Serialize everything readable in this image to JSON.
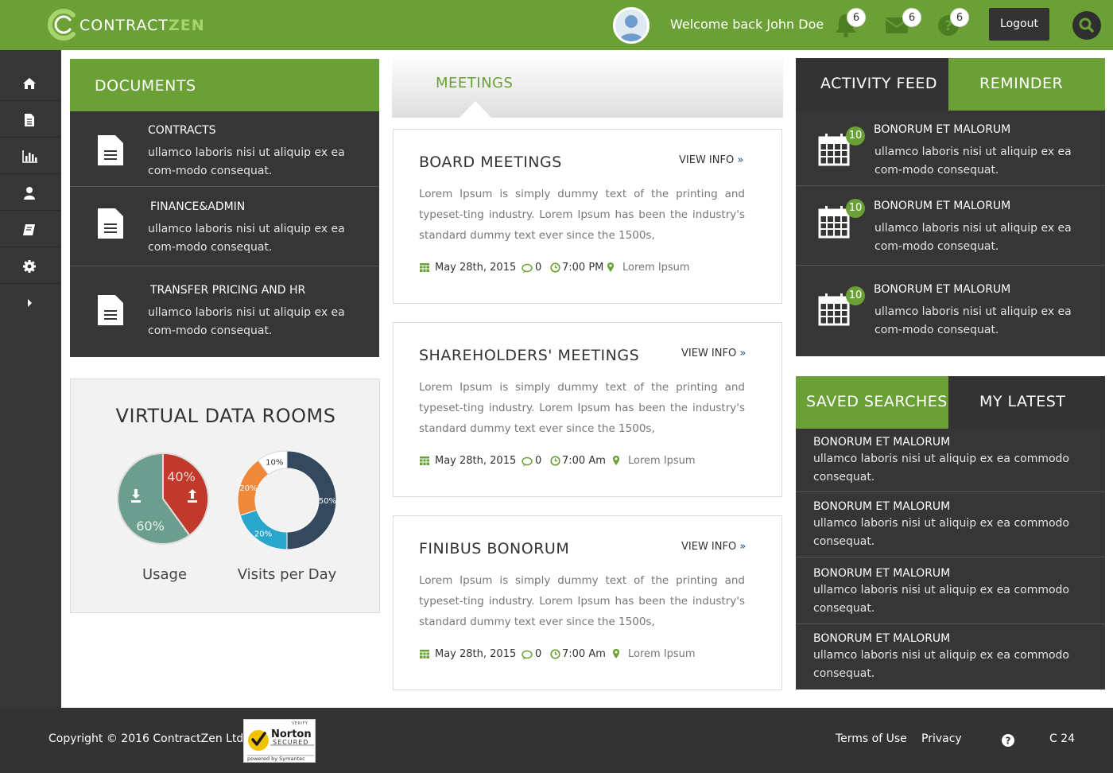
{
  "header": {
    "logo_part1": "CONTRACT",
    "logo_part2": "ZEN",
    "welcome": "Welcome back John Doe",
    "notifications": [
      {
        "icon": "bell-icon",
        "count": "6"
      },
      {
        "icon": "envelope-icon",
        "count": "6"
      },
      {
        "icon": "question-icon",
        "count": "6"
      }
    ],
    "logout_label": "Logout",
    "accent": "#6aa035"
  },
  "sidebar": {
    "items": [
      {
        "icon": "home-icon"
      },
      {
        "icon": "document-icon"
      },
      {
        "icon": "bar-chart-icon"
      },
      {
        "icon": "user-icon"
      },
      {
        "icon": "book-icon"
      },
      {
        "icon": "gear-icon"
      },
      {
        "icon": "chevron-right-icon"
      }
    ]
  },
  "documents": {
    "title": "DOCUMENTS",
    "items": [
      {
        "title": "CONTRACTS",
        "desc": "ullamco laboris nisi ut aliquip ex ea com-modo consequat."
      },
      {
        "title": "FINANCE&ADMIN",
        "desc": "ullamco laboris nisi ut aliquip ex ea com-modo consequat."
      },
      {
        "title": "TRANSFER PRICING AND HR",
        "desc": "ullamco laboris nisi ut aliquip ex ea com-modo consequat."
      }
    ]
  },
  "vdr": {
    "title": "VIRTUAL DATA ROOMS",
    "usage_label": "Usage",
    "visits_label": "Visits per Day"
  },
  "chart_data": [
    {
      "type": "pie",
      "title": "Usage",
      "categories": [
        "Download",
        "Upload"
      ],
      "values": [
        60,
        40
      ],
      "labels": [
        "60%",
        "40%"
      ],
      "colors": [
        "#6b9e8e",
        "#c0392b"
      ]
    },
    {
      "type": "pie",
      "title": "Visits per Day",
      "donut": true,
      "values": [
        50,
        20,
        20,
        10
      ],
      "labels": [
        "50%",
        "20%",
        "20%",
        "10%"
      ],
      "colors": [
        "#34495e",
        "#2aa6cc",
        "#f0883a",
        "#ffffff"
      ]
    }
  ],
  "meetings": {
    "title": "MEETINGS",
    "view_label": "VIEW INFO",
    "items": [
      {
        "title": "BOARD MEETINGS",
        "text": "Lorem Ipsum is simply dummy text of the printing and typeset-ting industry. Lorem Ipsum has been the industry's standard dummy text ever since the 1500s,",
        "date": "May 28th, 2015",
        "comments": "0",
        "time": "7:00 PM",
        "location": "Lorem Ipsum"
      },
      {
        "title": "SHAREHOLDERS' MEETINGS",
        "text": "Lorem Ipsum is simply dummy text of the printing and typeset-ting industry. Lorem Ipsum has been the industry's standard dummy text ever since the 1500s,",
        "date": "May 28th, 2015",
        "comments": "0",
        "time": "7:00 Am",
        "location": "Lorem Ipsum"
      },
      {
        "title": "FINIBUS BONORUM",
        "text": "Lorem Ipsum is simply dummy text of the printing and typeset-ting industry. Lorem Ipsum has been the industry's standard dummy text ever since the 1500s,",
        "date": "May 28th, 2015",
        "comments": "0",
        "time": "7:00 Am",
        "location": "Lorem Ipsum"
      }
    ]
  },
  "activity": {
    "tab_feed": "ACTIVITY FEED",
    "tab_reminder": "REMINDER",
    "items": [
      {
        "badge": "10",
        "title": "BONORUM ET MALORUM",
        "desc": "ullamco laboris nisi ut aliquip ex ea com-modo consequat."
      },
      {
        "badge": "10",
        "title": "BONORUM ET MALORUM",
        "desc": "ullamco laboris nisi ut aliquip ex ea com-modo consequat."
      },
      {
        "badge": "10",
        "title": "BONORUM ET MALORUM",
        "desc": "ullamco laboris nisi ut aliquip ex ea com-modo consequat."
      }
    ]
  },
  "saved": {
    "tab_saved": "SAVED SEARCHES",
    "tab_latest": "MY LATEST",
    "items": [
      {
        "title": "BONORUM ET MALORUM",
        "desc": "ullamco laboris nisi ut aliquip ex ea commodo consequat."
      },
      {
        "title": "BONORUM ET MALORUM",
        "desc": "ullamco laboris nisi ut aliquip ex ea commodo consequat."
      },
      {
        "title": "BONORUM ET MALORUM",
        "desc": "ullamco laboris nisi ut aliquip ex ea commodo consequat."
      },
      {
        "title": "BONORUM ET MALORUM",
        "desc": "ullamco laboris nisi ut aliquip ex ea commodo consequat."
      }
    ]
  },
  "footer": {
    "copyright": "Copyright © 2016 ContractZen Ltd",
    "norton_verify": "VERIFY",
    "norton_name": "Norton",
    "norton_secured": "SECURED",
    "norton_powered": "powered by Symantec",
    "terms": "Terms of Use",
    "privacy": "Privacy",
    "version": "C 24"
  }
}
